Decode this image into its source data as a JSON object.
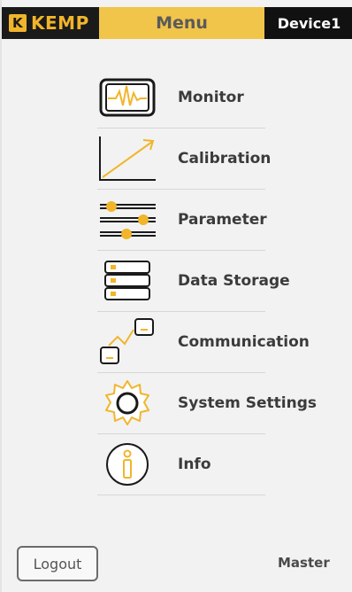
{
  "header": {
    "brand_mark": "K",
    "brand_name": "KEMP",
    "menu_title": "Menu",
    "device_label": "Device1"
  },
  "menu": {
    "items": [
      {
        "label": "Monitor",
        "icon": "monitor-icon"
      },
      {
        "label": "Calibration",
        "icon": "calibration-chart-icon"
      },
      {
        "label": "Parameter",
        "icon": "sliders-icon"
      },
      {
        "label": "Data Storage",
        "icon": "storage-icon"
      },
      {
        "label": "Communication",
        "icon": "communication-icon"
      },
      {
        "label": "System Settings",
        "icon": "gear-icon"
      },
      {
        "label": "Info",
        "icon": "info-icon"
      }
    ]
  },
  "footer": {
    "logout_label": "Logout",
    "role_label": "Master"
  },
  "colors": {
    "accent": "#f1b52b",
    "menu_tab": "#f1c44a",
    "dark": "#111111",
    "text": "#3b3b3b",
    "background": "#f2f2f2"
  }
}
